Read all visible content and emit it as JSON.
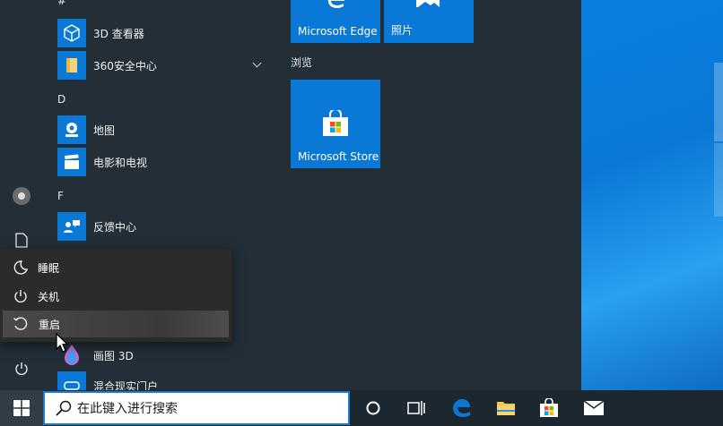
{
  "apps": {
    "hash_header": "#",
    "viewer3d": "3D 查看器",
    "security360": "360安全中心",
    "d_header": "D",
    "maps": "地图",
    "movies": "电影和电视",
    "f_header": "F",
    "feedback": "反馈中心",
    "paint3d": "画图 3D",
    "mixed_reality": "混合现实门户"
  },
  "tiles": {
    "edge": "Microsoft Edge",
    "photos": "照片",
    "browse_group": "浏览",
    "store": "Microsoft Store"
  },
  "power_menu": {
    "sleep": "睡眠",
    "shutdown": "关机",
    "restart": "重启"
  },
  "taskbar": {
    "search_placeholder": "在此键入进行搜索"
  },
  "colors": {
    "accent": "#0a78d7",
    "start_bg": "#232e37",
    "menu_bg": "#2b2b2b"
  }
}
